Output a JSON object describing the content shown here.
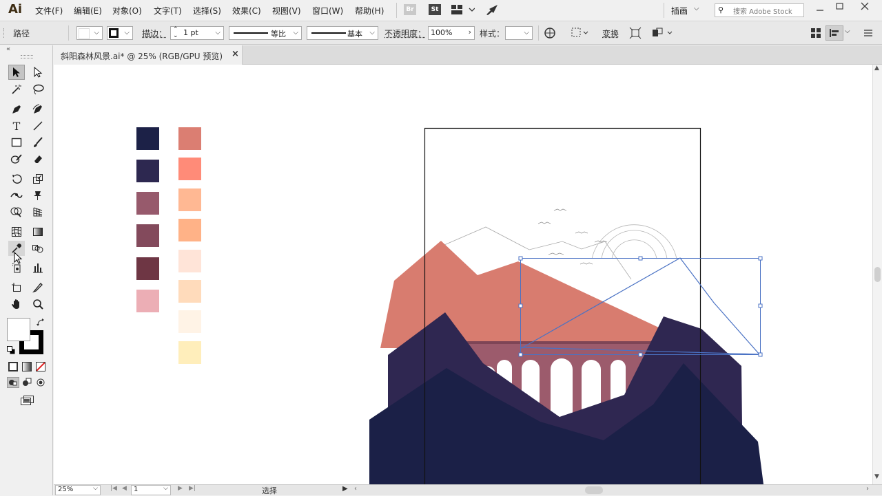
{
  "app": {
    "logo": "Ai"
  },
  "menu": [
    "文件(F)",
    "编辑(E)",
    "对象(O)",
    "文字(T)",
    "选择(S)",
    "效果(C)",
    "视图(V)",
    "窗口(W)",
    "帮助(H)"
  ],
  "top_icons": {
    "bridge": "Br",
    "stock": "St"
  },
  "workspace": {
    "label": "插画"
  },
  "search": {
    "placeholder": "搜索 Adobe Stock"
  },
  "control": {
    "selection_type": "路径",
    "stroke_label": "描边：",
    "stroke_weight": "1 pt",
    "profile_uniform": "等比",
    "brush_basic": "基本",
    "opacity_label": "不透明度：",
    "opacity_value": "100%",
    "style_label": "样式：",
    "transform_label": "变换"
  },
  "document": {
    "tab_title": "斜阳森林风景.ai* @ 25% (RGB/GPU 预览)",
    "close": "×"
  },
  "swatches": {
    "left": [
      "#1c2147",
      "#2d2850",
      "#975a6c",
      "#834a5c",
      "#6e3644",
      "#ecaeb5"
    ],
    "right": [
      "#db7e72",
      "#ff8b78",
      "#ffb893",
      "#ffb287",
      "#ffe4d8",
      "#ffdbbb",
      "#fff3e6",
      "#ffeebb"
    ]
  },
  "colors": {
    "mountain_back": "#d87c6f",
    "bridge": "#9c5b6c",
    "mountain_mid": "#2f2751",
    "mountain_front": "#1b2047",
    "selection": "#4a72c4"
  },
  "status": {
    "zoom": "25%",
    "artboard": "1",
    "tool": "选择"
  }
}
